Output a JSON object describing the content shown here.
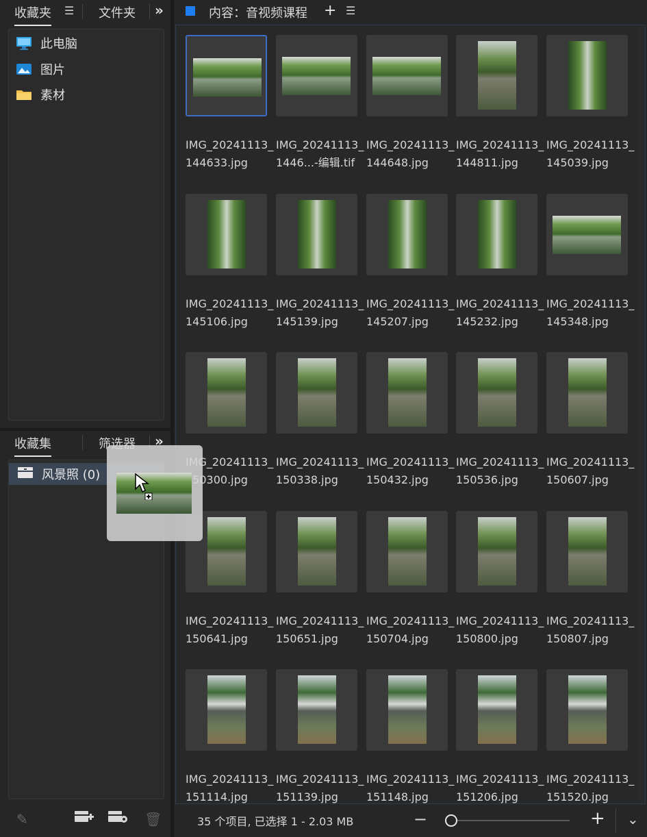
{
  "left_top": {
    "tabs": [
      "收藏夹",
      "文件夹"
    ],
    "items": [
      {
        "label": "此电脑",
        "icon": "computer-icon"
      },
      {
        "label": "图片",
        "icon": "pictures-folder-icon"
      },
      {
        "label": "素材",
        "icon": "folder-icon"
      }
    ]
  },
  "left_bottom": {
    "tabs": [
      "收藏集",
      "筛选器"
    ],
    "collection": {
      "label": "风景照 (0)",
      "icon": "collection-icon"
    }
  },
  "content": {
    "title": "内容：音视频课程",
    "items": [
      {
        "l1": "IMG_20241113_",
        "l2": "144633.jpg",
        "kind": "land",
        "selected": true
      },
      {
        "l1": "IMG_20241113_",
        "l2": "1446...-编辑.tif",
        "kind": "land"
      },
      {
        "l1": "IMG_20241113_",
        "l2": "144648.jpg",
        "kind": "land"
      },
      {
        "l1": "IMG_20241113_",
        "l2": "144811.jpg",
        "kind": "tree"
      },
      {
        "l1": "IMG_20241113_",
        "l2": "145039.jpg",
        "kind": "tallA"
      },
      {
        "l1": "IMG_20241113_",
        "l2": "145106.jpg",
        "kind": "tallA"
      },
      {
        "l1": "IMG_20241113_",
        "l2": "145139.jpg",
        "kind": "tallA"
      },
      {
        "l1": "IMG_20241113_",
        "l2": "145207.jpg",
        "kind": "tallA"
      },
      {
        "l1": "IMG_20241113_",
        "l2": "145232.jpg",
        "kind": "tallA"
      },
      {
        "l1": "IMG_20241113_",
        "l2": "145348.jpg",
        "kind": "land"
      },
      {
        "l1": "IMG_20241113_",
        "l2": "150300.jpg",
        "kind": "tree"
      },
      {
        "l1": "IMG_20241113_",
        "l2": "150338.jpg",
        "kind": "tree"
      },
      {
        "l1": "IMG_20241113_",
        "l2": "150432.jpg",
        "kind": "tree"
      },
      {
        "l1": "IMG_20241113_",
        "l2": "150536.jpg",
        "kind": "tree"
      },
      {
        "l1": "IMG_20241113_",
        "l2": "150607.jpg",
        "kind": "tree"
      },
      {
        "l1": "IMG_20241113_",
        "l2": "150641.jpg",
        "kind": "tree"
      },
      {
        "l1": "IMG_20241113_",
        "l2": "150651.jpg",
        "kind": "tree"
      },
      {
        "l1": "IMG_20241113_",
        "l2": "150704.jpg",
        "kind": "tree"
      },
      {
        "l1": "IMG_20241113_",
        "l2": "150800.jpg",
        "kind": "tree"
      },
      {
        "l1": "IMG_20241113_",
        "l2": "150807.jpg",
        "kind": "tree"
      },
      {
        "l1": "IMG_20241113_",
        "l2": "151114.jpg",
        "kind": "bridge"
      },
      {
        "l1": "IMG_20241113_",
        "l2": "151139.jpg",
        "kind": "bridge"
      },
      {
        "l1": "IMG_20241113_",
        "l2": "151148.jpg",
        "kind": "bridge"
      },
      {
        "l1": "IMG_20241113_",
        "l2": "151206.jpg",
        "kind": "bridge"
      },
      {
        "l1": "IMG_20241113_",
        "l2": "151520.jpg",
        "kind": "bridge"
      }
    ]
  },
  "status": {
    "text": "35 个项目, 已选择 1 - 2.03 MB"
  },
  "colors": {
    "accent": "#3e6cc6",
    "selected_row": "#3a4654"
  }
}
